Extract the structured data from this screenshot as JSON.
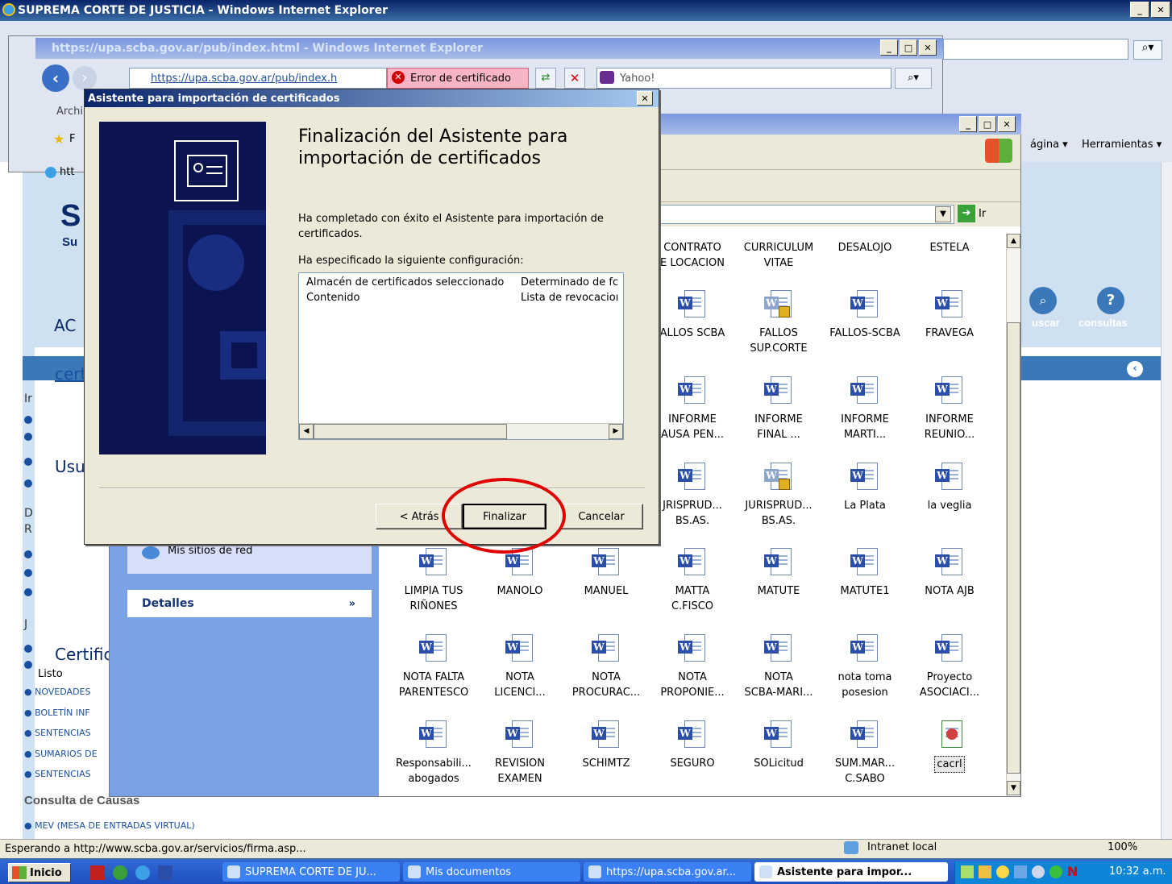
{
  "outer_window": {
    "title": "SUPREMA CORTE DE JUSTICIA - Windows Internet Explorer",
    "status": "Esperando a http://www.scba.gov.ar/servicios/firma.asp...",
    "zone": "Intranet local",
    "zoom": "100%",
    "menu_page": "ágina",
    "menu_tools": "Herramientas"
  },
  "page_bg": {
    "logo": "S",
    "logo_sub": "Su",
    "ac": "AC",
    "cert_link": "cert",
    "usu": "Usu",
    "certific": "Certific",
    "listo": "Listo",
    "links": [
      "NOVEDADES",
      "BOLETÍN INF",
      "SENTENCIAS",
      "SUMARIOS DE",
      "SENTENCIAS"
    ],
    "consulta": "Consulta de Causas",
    "mev": "MEV (MESA DE ENTRADAS VIRTUAL)",
    "buscar": "uscar",
    "consultas": "consultas",
    "side_letters": [
      "Ir",
      "D",
      "R",
      "J"
    ]
  },
  "second_window": {
    "title": "https://upa.scba.gov.ar/pub/index.html - Windows Internet Explorer",
    "url": "https://upa.scba.gov.ar/pub/index.h",
    "cert_error": "Error de certificado",
    "search": "Yahoo!",
    "menu_partial": "Archi",
    "tab_partial": "htt",
    "fav_partial": "F"
  },
  "explorer": {
    "go": "Ir",
    "network_places": "Mis sitios de red",
    "details": "Detalles",
    "files": [
      {
        "label": "CONTRATO\nE LOCACION",
        "icon": "none"
      },
      {
        "label": "CURRICULUM\nVITAE",
        "icon": "none"
      },
      {
        "label": "DESALOJO",
        "icon": "none"
      },
      {
        "label": "ESTELA",
        "icon": "none"
      },
      {
        "label": "ALLOS SCBA",
        "icon": "word"
      },
      {
        "label": "FALLOS\nSUP.CORTE",
        "icon": "lock"
      },
      {
        "label": "FALLOS-SCBA",
        "icon": "word"
      },
      {
        "label": "FRAVEGA",
        "icon": "word"
      },
      {
        "label": "INFORME\nAUSA PEN...",
        "icon": "word"
      },
      {
        "label": "INFORME\nFINAL ...",
        "icon": "word"
      },
      {
        "label": "INFORME\nMARTI...",
        "icon": "word"
      },
      {
        "label": "INFORME\nREUNIO...",
        "icon": "word"
      },
      {
        "label": "JRISPRUD...\nBS.AS.",
        "icon": "word"
      },
      {
        "label": "JURISPRUD...\nBS.AS.",
        "icon": "lock"
      },
      {
        "label": "La Plata",
        "icon": "word"
      },
      {
        "label": "la veglia",
        "icon": "word"
      },
      {
        "label": "LIMPIA TUS\nRIÑONES",
        "icon": "word"
      },
      {
        "label": "MANOLO",
        "icon": "word"
      },
      {
        "label": "MANUEL",
        "icon": "word"
      },
      {
        "label": "MATTA\nC.FISCO",
        "icon": "word"
      },
      {
        "label": "MATUTE",
        "icon": "word"
      },
      {
        "label": "MATUTE1",
        "icon": "word"
      },
      {
        "label": "NOTA AJB",
        "icon": "word"
      },
      {
        "label": "NOTA FALTA\nPARENTESCO",
        "icon": "word"
      },
      {
        "label": "NOTA\nLICENCI...",
        "icon": "word"
      },
      {
        "label": "NOTA\nPROCURAC...",
        "icon": "word"
      },
      {
        "label": "NOTA\nPROPONIE...",
        "icon": "word"
      },
      {
        "label": "NOTA\nSCBA-MARI...",
        "icon": "word"
      },
      {
        "label": "nota toma\nposesion",
        "icon": "word"
      },
      {
        "label": "Proyecto\nASOCIACI...",
        "icon": "word"
      },
      {
        "label": "Responsabili...\nabogados",
        "icon": "word"
      },
      {
        "label": "REVISION\nEXAMEN",
        "icon": "word"
      },
      {
        "label": "SCHIMTZ",
        "icon": "word"
      },
      {
        "label": "SEGURO",
        "icon": "word"
      },
      {
        "label": "SOLicitud",
        "icon": "word"
      },
      {
        "label": "SUM.MAR...\nC.SABO",
        "icon": "word"
      },
      {
        "label": "cacrl",
        "icon": "crl"
      }
    ]
  },
  "dialog": {
    "title": "Asistente para importación de certificados",
    "heading": "Finalización del Asistente para importación de certificados",
    "completed": "Ha completado con éxito el Asistente para importación de certificados.",
    "specified": "Ha especificado la siguiente configuración:",
    "rows": [
      {
        "key": "Almacén de certificados seleccionado",
        "value": "Determinado de fc"
      },
      {
        "key": "Contenido",
        "value": "Lista de revocacioı"
      }
    ],
    "back": "< Atrás",
    "finish": "Finalizar",
    "cancel": "Cancelar"
  },
  "taskbar": {
    "start": "Inicio",
    "tasks": [
      {
        "label": "SUPREMA CORTE DE JU...",
        "active": false
      },
      {
        "label": "Mis documentos",
        "active": false
      },
      {
        "label": "https://upa.scba.gov.ar...",
        "active": false
      },
      {
        "label": "Asistente para impor...",
        "active": true
      }
    ],
    "clock": "10:32 a.m."
  },
  "colors": {
    "highlight_circle": "#e00000",
    "title_active": "#0a246a",
    "dialog_banner": "#0b1450"
  }
}
